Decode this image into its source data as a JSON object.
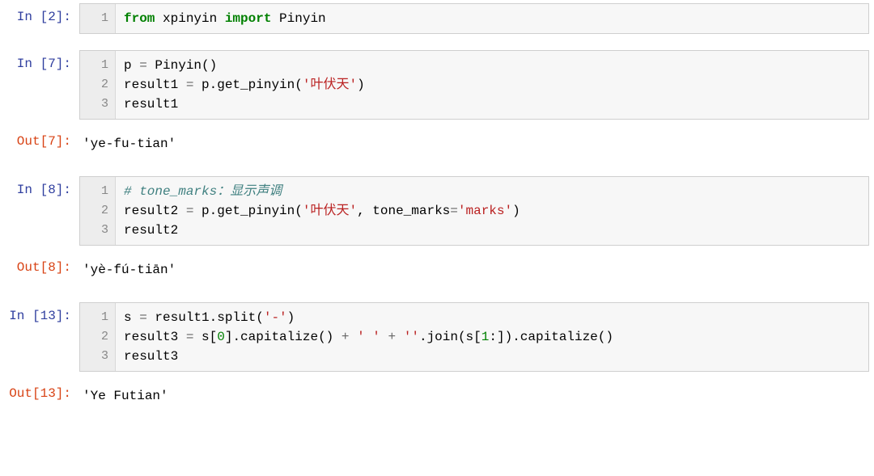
{
  "cells": [
    {
      "type": "in",
      "prompt": "In  [2]:",
      "lines": [
        "1"
      ],
      "code_html": "c0"
    },
    {
      "type": "spacer"
    },
    {
      "type": "in",
      "prompt": "In  [7]:",
      "lines": [
        "1",
        "2",
        "3"
      ],
      "code_html": "c1"
    },
    {
      "type": "spacer-sm"
    },
    {
      "type": "out",
      "prompt": "Out[7]:",
      "output": "'ye-fu-tian'"
    },
    {
      "type": "spacer"
    },
    {
      "type": "in",
      "prompt": "In  [8]:",
      "lines": [
        "1",
        "2",
        "3"
      ],
      "code_html": "c2"
    },
    {
      "type": "spacer-sm"
    },
    {
      "type": "out",
      "prompt": "Out[8]:",
      "output": "'yè-fú-tiān'"
    },
    {
      "type": "spacer"
    },
    {
      "type": "in",
      "prompt": "In  [13]:",
      "lines": [
        "1",
        "2",
        "3"
      ],
      "code_html": "c3"
    },
    {
      "type": "spacer-sm"
    },
    {
      "type": "out",
      "prompt": "Out[13]:",
      "output": "'Ye Futian'"
    }
  ],
  "code": {
    "c0": [
      [
        {
          "t": "from",
          "c": "kw-green"
        },
        {
          "t": " xpinyin ",
          "c": ""
        },
        {
          "t": "import",
          "c": "kw-green"
        },
        {
          "t": " Pinyin",
          "c": ""
        }
      ]
    ],
    "c1": [
      [
        {
          "t": "p ",
          "c": ""
        },
        {
          "t": "=",
          "c": "op"
        },
        {
          "t": " Pinyin()",
          "c": ""
        }
      ],
      [
        {
          "t": "result1 ",
          "c": ""
        },
        {
          "t": "=",
          "c": "op"
        },
        {
          "t": " p.get_pinyin(",
          "c": ""
        },
        {
          "t": "'叶伏天'",
          "c": "str"
        },
        {
          "t": ")",
          "c": ""
        }
      ],
      [
        {
          "t": "result1",
          "c": ""
        }
      ]
    ],
    "c2": [
      [
        {
          "t": "# tone_marks：显示声调",
          "c": "comment"
        }
      ],
      [
        {
          "t": "result2 ",
          "c": ""
        },
        {
          "t": "=",
          "c": "op"
        },
        {
          "t": " p.get_pinyin(",
          "c": ""
        },
        {
          "t": "'叶伏天'",
          "c": "str"
        },
        {
          "t": ", tone_marks",
          "c": ""
        },
        {
          "t": "=",
          "c": "op"
        },
        {
          "t": "'marks'",
          "c": "str"
        },
        {
          "t": ")",
          "c": ""
        }
      ],
      [
        {
          "t": "result2",
          "c": ""
        }
      ]
    ],
    "c3": [
      [
        {
          "t": "s ",
          "c": ""
        },
        {
          "t": "=",
          "c": "op"
        },
        {
          "t": " result1.split(",
          "c": ""
        },
        {
          "t": "'-'",
          "c": "str"
        },
        {
          "t": ")",
          "c": ""
        }
      ],
      [
        {
          "t": "result3 ",
          "c": ""
        },
        {
          "t": "=",
          "c": "op"
        },
        {
          "t": " s[",
          "c": ""
        },
        {
          "t": "0",
          "c": "num"
        },
        {
          "t": "].capitalize() ",
          "c": ""
        },
        {
          "t": "+",
          "c": "op"
        },
        {
          "t": " ",
          "c": ""
        },
        {
          "t": "' '",
          "c": "str"
        },
        {
          "t": " ",
          "c": ""
        },
        {
          "t": "+",
          "c": "op"
        },
        {
          "t": " ",
          "c": ""
        },
        {
          "t": "''",
          "c": "str"
        },
        {
          "t": ".join(s[",
          "c": ""
        },
        {
          "t": "1",
          "c": "num"
        },
        {
          "t": ":]).capitalize()",
          "c": ""
        }
      ],
      [
        {
          "t": "result3",
          "c": ""
        }
      ]
    ]
  }
}
